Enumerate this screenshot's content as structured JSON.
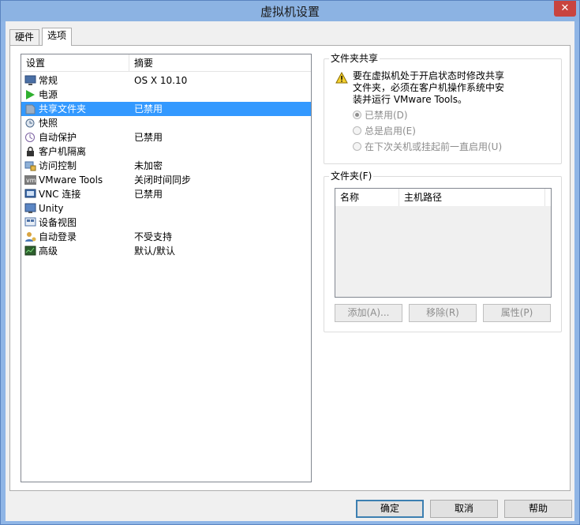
{
  "window": {
    "title": "虚拟机设置",
    "close_glyph": "✕"
  },
  "tabs": [
    {
      "label": "硬件",
      "active": false
    },
    {
      "label": "选项",
      "active": true
    }
  ],
  "settings_list": {
    "headers": {
      "setting": "设置",
      "summary": "摘要"
    },
    "rows": [
      {
        "name": "常规",
        "summary": "OS X 10.10",
        "icon": "monitor-icon"
      },
      {
        "name": "电源",
        "summary": "",
        "icon": "power-play-icon"
      },
      {
        "name": "共享文件夹",
        "summary": "已禁用",
        "icon": "shared-folder-icon",
        "selected": true
      },
      {
        "name": "快照",
        "summary": "",
        "icon": "snapshot-icon"
      },
      {
        "name": "自动保护",
        "summary": "已禁用",
        "icon": "autoprotect-icon"
      },
      {
        "name": "客户机隔离",
        "summary": "",
        "icon": "lock-icon"
      },
      {
        "name": "访问控制",
        "summary": "未加密",
        "icon": "access-control-icon"
      },
      {
        "name": "VMware Tools",
        "summary": "关闭时间同步",
        "icon": "vmware-tools-icon"
      },
      {
        "name": "VNC 连接",
        "summary": "已禁用",
        "icon": "vnc-icon"
      },
      {
        "name": "Unity",
        "summary": "",
        "icon": "unity-icon"
      },
      {
        "name": "设备视图",
        "summary": "",
        "icon": "device-view-icon"
      },
      {
        "name": "自动登录",
        "summary": "不受支持",
        "icon": "autologin-icon"
      },
      {
        "name": "高级",
        "summary": "默认/默认",
        "icon": "advanced-icon"
      }
    ]
  },
  "folder_sharing": {
    "title": "文件夹共享",
    "warning_lines": [
      "要在虚拟机处于开启状态时修改共享",
      "文件夹，必须在客户机操作系统中安",
      "装并运行 VMware Tools。"
    ],
    "options": [
      {
        "label": "已禁用(D)",
        "checked": true
      },
      {
        "label": "总是启用(E)",
        "checked": false
      },
      {
        "label": "在下次关机或挂起前一直启用(U)",
        "checked": false
      }
    ]
  },
  "folders": {
    "title": "文件夹(F)",
    "columns": {
      "name": "名称",
      "host_path": "主机路径"
    },
    "buttons": {
      "add": "添加(A)...",
      "remove": "移除(R)",
      "properties": "属性(P)"
    }
  },
  "footer": {
    "ok": "确定",
    "cancel": "取消",
    "help": "帮助"
  },
  "colors": {
    "selection": "#3399ff",
    "titlebar": "#8cb3e3",
    "close": "#c8443f"
  }
}
